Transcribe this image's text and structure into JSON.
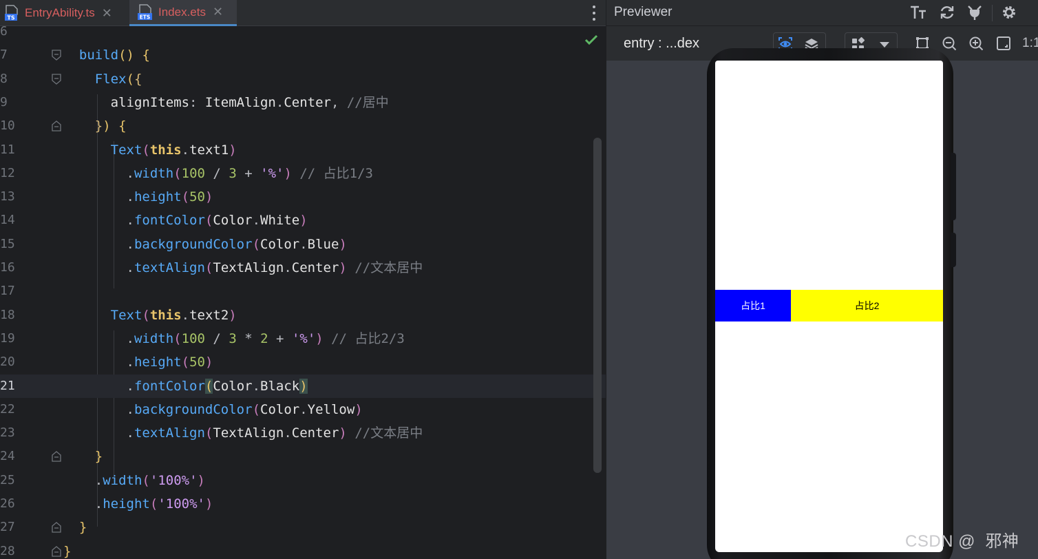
{
  "editor": {
    "tabs": [
      {
        "label": "EntryAbility.ts",
        "icon": "typescript-file-icon",
        "badge": "TS"
      },
      {
        "label": "Index.ets",
        "icon": "ets-file-icon",
        "badge": "ETS",
        "active": true
      }
    ],
    "current_line": 21,
    "lines": [
      {
        "n": "6",
        "fold": "none",
        "html": ""
      },
      {
        "n": "7",
        "fold": "open",
        "html": "<span class='op'>  </span><span class='fx'>build</span><span class='p'>()</span> <span class='p'>{</span>"
      },
      {
        "n": "8",
        "fold": "open",
        "html": "    <span class='fx'>Flex</span><span class='p'>(</span><span class='p2'>{</span>"
      },
      {
        "n": "9",
        "fold": "none",
        "html": "      <span class='w'>alignItems</span><span class='op'>: </span><span class='w'>ItemAlign</span><span class='op'>.</span><span class='w'>Center</span><span class='op'>, </span><span class='c'>//居中</span>"
      },
      {
        "n": "10",
        "fold": "close",
        "html": "    <span class='p2'>}</span><span class='p'>)</span> <span class='p'>{</span>"
      },
      {
        "n": "11",
        "fold": "none",
        "html": "      <span class='fx'>Text</span><span class='pr'>(</span><span class='p'><b>this</b></span><span class='op'>.</span><span class='w'>text1</span><span class='pr'>)</span>"
      },
      {
        "n": "12",
        "fold": "none",
        "html": "        <span class='op'>.</span><span class='fx'>width</span><span class='pr'>(</span><span class='n'>100</span> <span class='op'>/</span> <span class='n'>3</span> <span class='op'>+</span> <span class='st'>'%'</span><span class='pr'>)</span> <span class='c'>// 占比1/3</span>"
      },
      {
        "n": "13",
        "fold": "none",
        "html": "        <span class='op'>.</span><span class='fx'>height</span><span class='pr'>(</span><span class='n'>50</span><span class='pr'>)</span>"
      },
      {
        "n": "14",
        "fold": "none",
        "html": "        <span class='op'>.</span><span class='fx'>fontColor</span><span class='pr'>(</span><span class='w'>Color</span><span class='op'>.</span><span class='w'>White</span><span class='pr'>)</span>"
      },
      {
        "n": "15",
        "fold": "none",
        "html": "        <span class='op'>.</span><span class='fx'>backgroundColor</span><span class='pr'>(</span><span class='w'>Color</span><span class='op'>.</span><span class='w'>Blue</span><span class='pr'>)</span>"
      },
      {
        "n": "16",
        "fold": "none",
        "html": "        <span class='op'>.</span><span class='fx'>textAlign</span><span class='pr'>(</span><span class='w'>TextAlign</span><span class='op'>.</span><span class='w'>Center</span><span class='pr'>)</span> <span class='c'>//文本居中</span>"
      },
      {
        "n": "17",
        "fold": "none",
        "html": ""
      },
      {
        "n": "18",
        "fold": "none",
        "html": "      <span class='fx'>Text</span><span class='pr'>(</span><span class='p'><b>this</b></span><span class='op'>.</span><span class='w'>text2</span><span class='pr'>)</span>"
      },
      {
        "n": "19",
        "fold": "none",
        "html": "        <span class='op'>.</span><span class='fx'>width</span><span class='pr'>(</span><span class='n'>100</span> <span class='op'>/</span> <span class='n'>3</span> <span class='op'>*</span> <span class='n'>2</span> <span class='op'>+</span> <span class='st'>'%'</span><span class='pr'>)</span> <span class='c'>// 占比2/3</span>"
      },
      {
        "n": "20",
        "fold": "none",
        "html": "        <span class='op'>.</span><span class='fx'>height</span><span class='pr'>(</span><span class='n'>50</span><span class='pr'>)</span>"
      },
      {
        "n": "21",
        "fold": "none",
        "html": "        <span class='op'>.</span><span class='fx'>fontColor</span><span class='p' style='background:#3b514d'>(</span><span class='w'>Color</span><span class='op'>.</span><span class='w'>Black</span><span class='p' style='background:#3b514d'>)</span>"
      },
      {
        "n": "22",
        "fold": "none",
        "html": "        <span class='op'>.</span><span class='fx'>backgroundColor</span><span class='pr'>(</span><span class='w'>Color</span><span class='op'>.</span><span class='w'>Yellow</span><span class='pr'>)</span>"
      },
      {
        "n": "23",
        "fold": "none",
        "html": "        <span class='op'>.</span><span class='fx'>textAlign</span><span class='pr'>(</span><span class='w'>TextAlign</span><span class='op'>.</span><span class='w'>Center</span><span class='pr'>)</span> <span class='c'>//文本居中</span>"
      },
      {
        "n": "24",
        "fold": "close",
        "html": "    <span class='p'>}</span>"
      },
      {
        "n": "25",
        "fold": "none",
        "html": "    <span class='op'>.</span><span class='fx'>width</span><span class='pr'>(</span><span class='st'>'100%'</span><span class='pr'>)</span>"
      },
      {
        "n": "26",
        "fold": "none",
        "html": "    <span class='op'>.</span><span class='fx'>height</span><span class='pr'>(</span><span class='st'>'100%'</span><span class='pr'>)</span>"
      },
      {
        "n": "27",
        "fold": "close",
        "html": "  <span class='p'>}</span>"
      },
      {
        "n": "28",
        "fold": "close",
        "html": "<span class='p'>}</span>"
      }
    ]
  },
  "previewer": {
    "title": "Previewer",
    "entry_label": "entry : ...dex",
    "ratio_label": "1:1",
    "header_icons": [
      "text-size-icon",
      "refresh-icon",
      "plug-icon",
      "gear-icon"
    ],
    "toolbar_icons": [
      "inspector-eye-icon",
      "layers-icon",
      "components-grid-icon",
      "chevron-down-icon",
      "frame-icon",
      "zoom-out-icon",
      "zoom-in-icon",
      "fit-screen-icon"
    ],
    "device": {
      "box1": {
        "text": "占比1",
        "background": "#0000ff",
        "color": "#ffffff"
      },
      "box2": {
        "text": "占比2",
        "background": "#ffff00",
        "color": "#000000"
      }
    }
  },
  "watermark": "CSDN @  邪神",
  "colors": {
    "editor_bg": "#1e1f22",
    "tab_label": "#d75f5f",
    "accent_blue": "#4a88c7",
    "check_green": "#5fb865"
  }
}
